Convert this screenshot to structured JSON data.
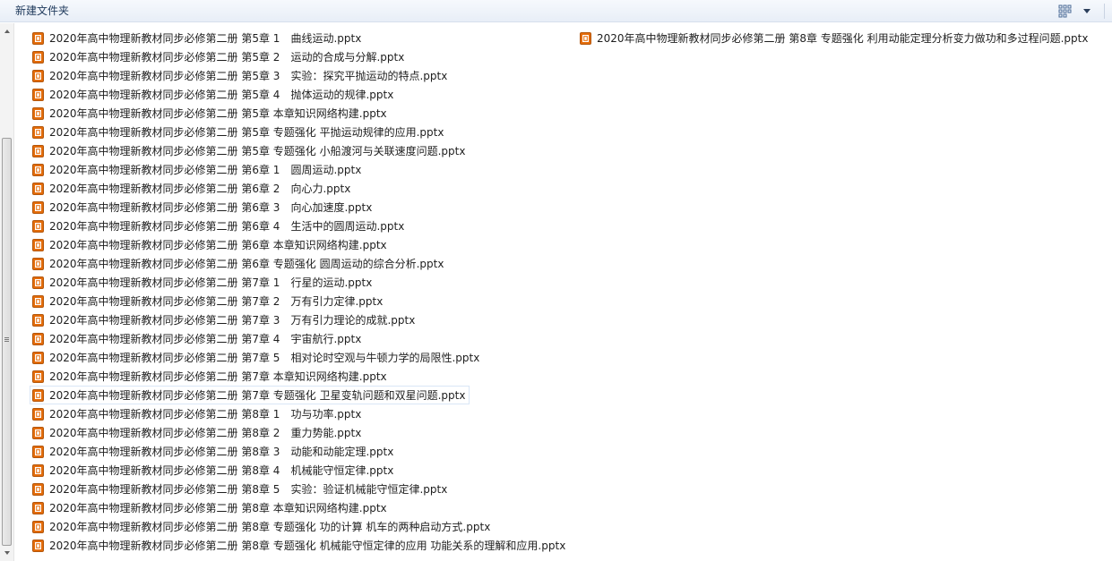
{
  "toolbar": {
    "new_folder_label": "新建文件夹",
    "view_icon": "view-options-icon",
    "arrow_icon": "chevron-down-icon"
  },
  "colors": {
    "ppt_icon": "#e46c0a",
    "toolbar_text": "#1e395b",
    "selection_border": "#d9e6f6"
  },
  "files": {
    "column1": [
      {
        "name": "2020年高中物理新教材同步必修第二册 第5章 1　曲线运动.pptx"
      },
      {
        "name": "2020年高中物理新教材同步必修第二册 第5章 2　运动的合成与分解.pptx"
      },
      {
        "name": "2020年高中物理新教材同步必修第二册 第5章 3　实验：探究平抛运动的特点.pptx"
      },
      {
        "name": "2020年高中物理新教材同步必修第二册 第5章 4　抛体运动的规律.pptx"
      },
      {
        "name": "2020年高中物理新教材同步必修第二册 第5章 本章知识网络构建.pptx"
      },
      {
        "name": "2020年高中物理新教材同步必修第二册 第5章 专题强化 平抛运动规律的应用.pptx"
      },
      {
        "name": "2020年高中物理新教材同步必修第二册 第5章 专题强化 小船渡河与关联速度问题.pptx"
      },
      {
        "name": "2020年高中物理新教材同步必修第二册 第6章 1　圆周运动.pptx"
      },
      {
        "name": "2020年高中物理新教材同步必修第二册 第6章 2　向心力.pptx"
      },
      {
        "name": "2020年高中物理新教材同步必修第二册 第6章 3　向心加速度.pptx"
      },
      {
        "name": "2020年高中物理新教材同步必修第二册 第6章 4　生活中的圆周运动.pptx"
      },
      {
        "name": "2020年高中物理新教材同步必修第二册 第6章 本章知识网络构建.pptx"
      },
      {
        "name": "2020年高中物理新教材同步必修第二册 第6章 专题强化 圆周运动的综合分析.pptx"
      },
      {
        "name": "2020年高中物理新教材同步必修第二册 第7章 1　行星的运动.pptx"
      },
      {
        "name": "2020年高中物理新教材同步必修第二册 第7章 2　万有引力定律.pptx"
      },
      {
        "name": "2020年高中物理新教材同步必修第二册 第7章 3　万有引力理论的成就.pptx"
      },
      {
        "name": "2020年高中物理新教材同步必修第二册 第7章 4　宇宙航行.pptx"
      },
      {
        "name": "2020年高中物理新教材同步必修第二册 第7章 5　相对论时空观与牛顿力学的局限性.pptx"
      },
      {
        "name": "2020年高中物理新教材同步必修第二册 第7章 本章知识网络构建.pptx"
      },
      {
        "name": "2020年高中物理新教材同步必修第二册 第7章 专题强化 卫星变轨问题和双星问题.pptx",
        "selected": true
      },
      {
        "name": "2020年高中物理新教材同步必修第二册 第8章 1　功与功率.pptx"
      },
      {
        "name": "2020年高中物理新教材同步必修第二册 第8章 2　重力势能.pptx"
      },
      {
        "name": "2020年高中物理新教材同步必修第二册 第8章 3　动能和动能定理.pptx"
      },
      {
        "name": "2020年高中物理新教材同步必修第二册 第8章 4　机械能守恒定律.pptx"
      },
      {
        "name": "2020年高中物理新教材同步必修第二册 第8章 5　实验：验证机械能守恒定律.pptx"
      },
      {
        "name": "2020年高中物理新教材同步必修第二册 第8章 本章知识网络构建.pptx"
      },
      {
        "name": "2020年高中物理新教材同步必修第二册 第8章 专题强化 功的计算 机车的两种启动方式.pptx"
      },
      {
        "name": "2020年高中物理新教材同步必修第二册 第8章 专题强化 机械能守恒定律的应用 功能关系的理解和应用.pptx"
      }
    ],
    "column2": [
      {
        "name": "2020年高中物理新教材同步必修第二册 第8章 专题强化 利用动能定理分析变力做功和多过程问题.pptx"
      }
    ]
  }
}
